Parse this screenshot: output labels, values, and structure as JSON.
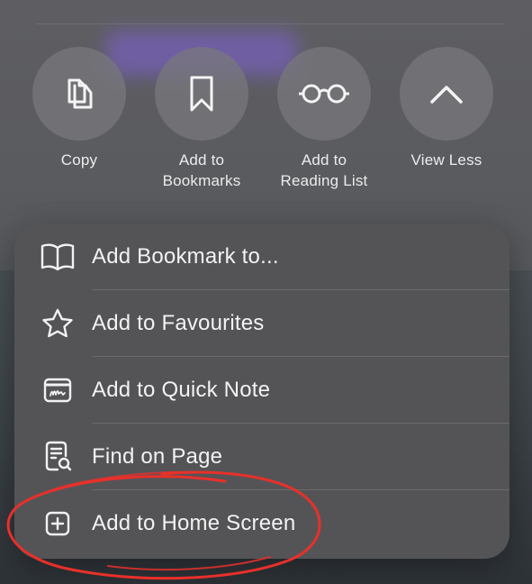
{
  "actions": [
    {
      "label": "Copy",
      "icon": "copy-icon"
    },
    {
      "label": "Add to\nBookmarks",
      "icon": "bookmark-icon"
    },
    {
      "label": "Add to\nReading List",
      "icon": "glasses-icon"
    },
    {
      "label": "View Less",
      "icon": "chevron-up-icon"
    }
  ],
  "menu": [
    {
      "label": "Add Bookmark to...",
      "icon": "book-icon"
    },
    {
      "label": "Add to Favourites",
      "icon": "star-icon"
    },
    {
      "label": "Add to Quick Note",
      "icon": "quick-note-icon"
    },
    {
      "label": "Find on Page",
      "icon": "find-on-page-icon"
    },
    {
      "label": "Add to Home Screen",
      "icon": "add-square-icon"
    }
  ],
  "colors": {
    "annotation": "#e8302a",
    "menu_bg": "#545457",
    "text": "#f2f2f2"
  }
}
